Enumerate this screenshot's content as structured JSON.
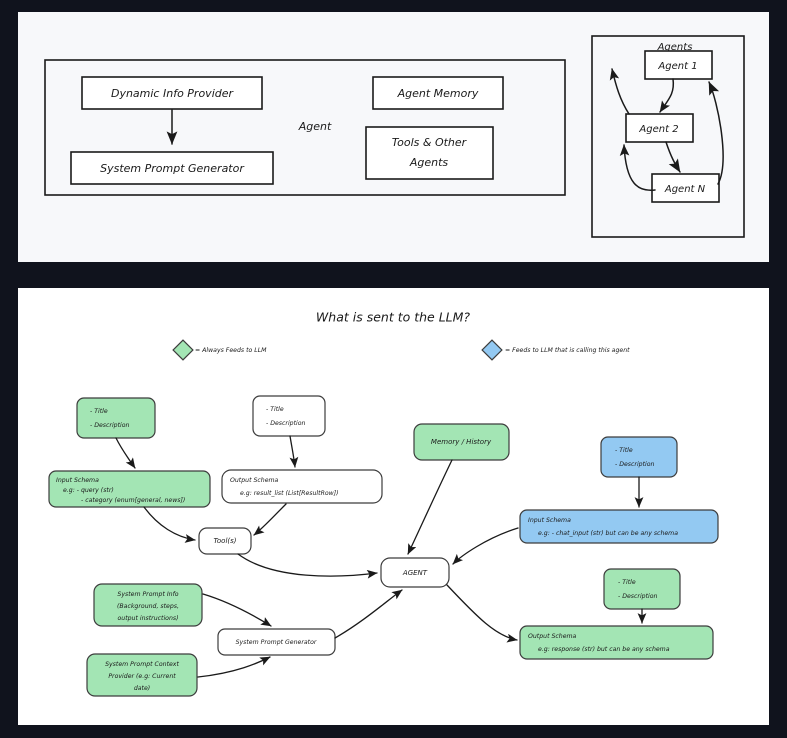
{
  "theme": {
    "background": "#10131d",
    "panel_top_bg": "#f7f8fa",
    "panel_bottom_bg": "#ffffff",
    "green": "#a3e5b4",
    "blue": "#93c9f2",
    "ink": "#1a1a1a"
  },
  "top_panel": {
    "agent_group_label": "Agent",
    "boxes": [
      {
        "id": "dynamic-info-provider",
        "label": "Dynamic Info Provider"
      },
      {
        "id": "system-prompt-generator",
        "label": "System Prompt Generator"
      },
      {
        "id": "agent-memory",
        "label": "Agent Memory"
      },
      {
        "id": "tools-and-other-agents",
        "label_line1": "Tools & Other",
        "label_line2": "Agents"
      }
    ],
    "agents_group": {
      "title": "Agents",
      "nodes": [
        {
          "id": "agent-1",
          "label": "Agent 1"
        },
        {
          "id": "agent-2",
          "label": "Agent 2"
        },
        {
          "id": "agent-n",
          "label": "Agent N"
        }
      ]
    }
  },
  "bottom_panel": {
    "title": "What is sent to the LLM?",
    "legend": [
      {
        "id": "legend-green",
        "color": "#a3e5b4",
        "text": "= Always Feeds to LLM"
      },
      {
        "id": "legend-blue",
        "color": "#93c9f2",
        "text": "= Feeds to LLM that is calling this agent"
      }
    ],
    "nodes": {
      "tool_title_desc": {
        "line1": "- Title",
        "line2": "- Description"
      },
      "tool_input_schema": {
        "line1": "Input Schema",
        "line2": "e.g: - query (str)",
        "line3": "- category (enum[general, news])"
      },
      "output_title_desc": {
        "line1": "- Title",
        "line2": "- Description"
      },
      "tool_output_schema": {
        "line1": "Output Schema",
        "line2": "e.g: result_list (List[ResultRow])"
      },
      "tools": {
        "label": "Tool(s)"
      },
      "memory_history": {
        "label": "Memory / History"
      },
      "agent": {
        "label": "AGENT"
      },
      "agent_input_title_desc": {
        "line1": "- Title",
        "line2": "- Description"
      },
      "agent_input_schema": {
        "line1": "Input Schema",
        "line2": "e.g: - chat_input (str) but can be any schema"
      },
      "agent_output_title_desc": {
        "line1": "- Title",
        "line2": "- Description"
      },
      "agent_output_schema": {
        "line1": "Output Schema",
        "line2": "e.g: response (str) but can be any schema"
      },
      "system_prompt_info": {
        "line1": "System Prompt Info",
        "line2": "(Background, steps,",
        "line3": "output instructions)"
      },
      "system_prompt_context_provider": {
        "line1": "System Prompt Context",
        "line2": "Provider (e.g: Current",
        "line3": "date)"
      },
      "system_prompt_generator": {
        "label": "System Prompt Generator"
      }
    }
  }
}
